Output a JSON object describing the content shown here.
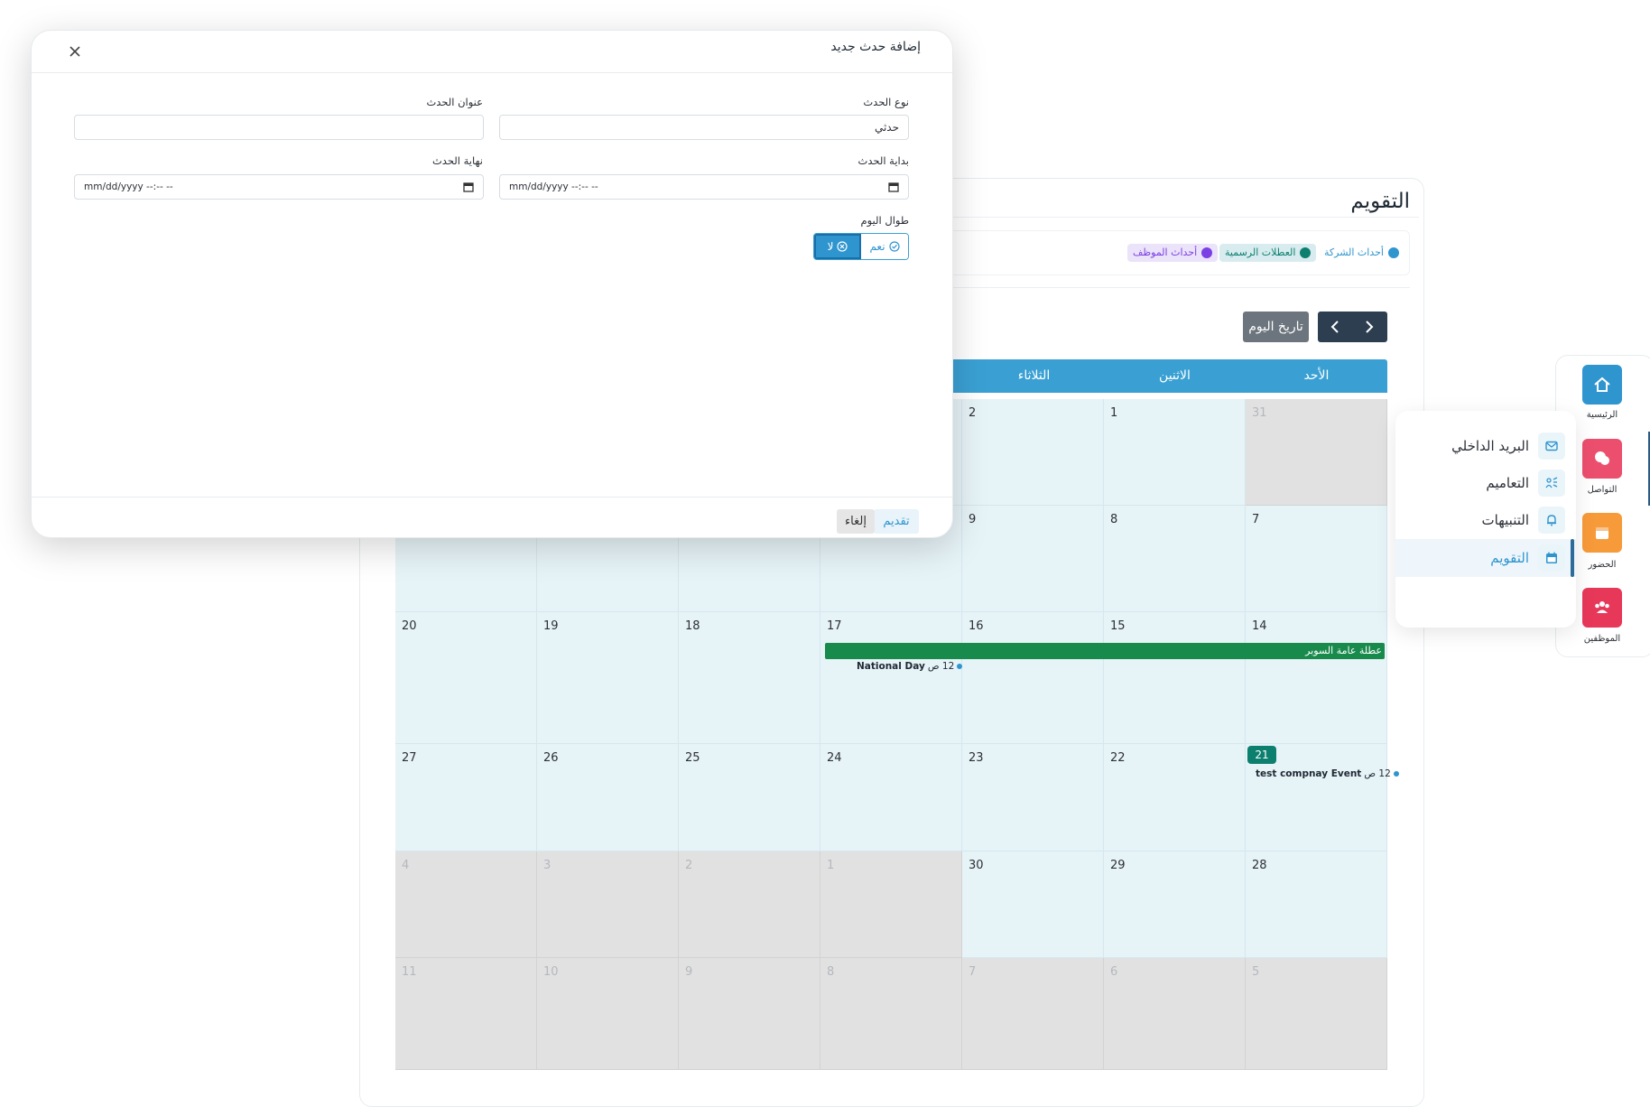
{
  "calendar": {
    "title": "التقويم",
    "legend": [
      {
        "label": "أحداث الشركة",
        "color": "#2f95cf",
        "bg": "#ffffff"
      },
      {
        "label": "العطلات الرسمية",
        "color": "#0d7f6f",
        "bg": "#d8ecef"
      },
      {
        "label": "أحداث الموظف",
        "color": "#7b3fe4",
        "bg": "#ebe3f9"
      }
    ],
    "nav": {
      "prev_icon": "chevron-left-icon",
      "next_icon": "chevron-right-icon"
    },
    "today_label": "تاريخ اليوم",
    "day_names": [
      "الأحد",
      "الاثنين",
      "الثلاثاء"
    ],
    "weeks": [
      [
        "31",
        "1",
        "2",
        "",
        "",
        "",
        ""
      ],
      [
        "7",
        "8",
        "9",
        "",
        "",
        "",
        ""
      ],
      [
        "14",
        "15",
        "16",
        "17",
        "18",
        "19",
        "20"
      ],
      [
        "21",
        "22",
        "23",
        "24",
        "25",
        "26",
        "27"
      ],
      [
        "28",
        "29",
        "30",
        "1",
        "2",
        "3",
        "4"
      ],
      [
        "5",
        "6",
        "7",
        "8",
        "9",
        "10",
        "11"
      ]
    ],
    "holiday_event": "عطلة عامة السوبر",
    "event_national": {
      "time": "12 ص",
      "title": "National Day"
    },
    "event_company": {
      "time": "12 ص",
      "title": "test compnay Event"
    },
    "today_day": "21"
  },
  "sidebar": {
    "items": [
      {
        "label": "الرئيسية",
        "icon": "home-icon",
        "color": "#2f95cf"
      },
      {
        "label": "التواصل",
        "icon": "chat-icon",
        "color": "#ec4f6e"
      },
      {
        "label": "الحضور",
        "icon": "attendance-icon",
        "color": "#f79a3a"
      },
      {
        "label": "الموظفين",
        "icon": "users-icon",
        "color": "#e8385a"
      }
    ]
  },
  "flyout": {
    "items": [
      {
        "label": "البريد الداخلي",
        "icon": "mail-icon"
      },
      {
        "label": "التعاميم",
        "icon": "announcement-icon"
      },
      {
        "label": "التنبيهات",
        "icon": "bell-icon"
      },
      {
        "label": "التقويم",
        "icon": "calendar-icon"
      }
    ]
  },
  "modal": {
    "title": "إضافة حدث جديد",
    "event_type_label": "نوع الحدث",
    "event_type_value": "حدثي",
    "event_title_label": "عنوان الحدث",
    "event_title_value": "",
    "start_label": "بداية الحدث",
    "start_placeholder": "mm/dd/yyyy --:-- --",
    "end_label": "نهاية الحدث",
    "end_placeholder": "mm/dd/yyyy --:-- --",
    "allday_label": "طوال اليوم",
    "allday_yes": "نعم",
    "allday_no": "لا",
    "submit_label": "تقديم",
    "cancel_label": "إلغاء"
  }
}
